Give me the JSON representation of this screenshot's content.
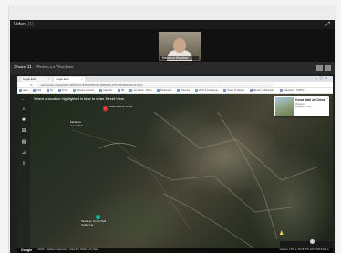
{
  "video_panel": {
    "title": "Video",
    "count": "(1)",
    "expand_icon": "expand-icon",
    "participant_name": "Rebecca Wardlaw"
  },
  "share_panel": {
    "title": "Share 11",
    "presenter": "Rebecca Wardlaw",
    "controls": [
      "layout-icon",
      "fullscreen-icon"
    ]
  },
  "browser": {
    "tabs": [
      {
        "label": "Google Earth"
      },
      {
        "label": "Google Earth"
      }
    ],
    "url": "earth.google.com/web/@40.43591379,116.56394765,691.34955426a,1573.48278082d,35y,0h,45t,0r",
    "bookmarks": [
      "Apps",
      "Mail",
      "AA",
      "Portal",
      "Campus Lessons",
      "Calendar",
      "HR",
      "Jon & Eric - Home",
      "Bookmarks",
      "Planning",
      "WHO & Colleagues",
      "Power of Nations",
      "Ministry of Education",
      "Collections - HWPS"
    ]
  },
  "map": {
    "hint": "Select a location highlighted in blue to enter Street View.",
    "labels": [
      {
        "id": "great-wall",
        "text": "Great Wall of China"
      },
      {
        "id": "mutianyu",
        "text": "Mutianyu\nGreat Wall"
      },
      {
        "id": "mutianyu-cable",
        "text": "Mutianyu Great Wall\nCable Car"
      }
    ],
    "card": {
      "title": "Great Wall of China",
      "sub1": "Mutianyu",
      "sub2": "Huairou, China"
    },
    "status_brand": "Google",
    "status_attrib": "©2019 · Landsat / Copernicus · Data SIO, NOAA, U.S. Navy",
    "status_right": "Camera: 1,551 m   40°25'49\"N 116°33'36\"E  691 m"
  },
  "colors": {
    "accent_red_pin": "#e53935",
    "accent_teal_pin": "#19b5a8",
    "header_dark": "#1a1a1a"
  }
}
